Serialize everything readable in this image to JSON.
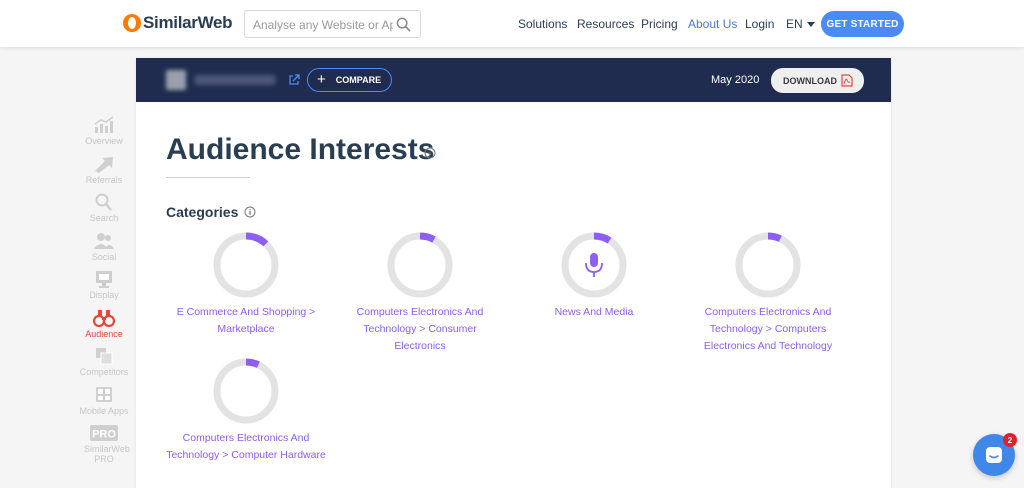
{
  "nav": {
    "logo_text": "SimilarWeb",
    "search_placeholder": "Analyse any Website or App",
    "links": [
      "Solutions",
      "Resources",
      "Pricing",
      "About Us",
      "Login"
    ],
    "active_link": "About Us",
    "language": "EN",
    "cta_label": "GET STARTED",
    "accent_color": "#4b8bf5"
  },
  "sidebar": {
    "items": [
      {
        "label": "Overview",
        "icon": "chart-icon"
      },
      {
        "label": "Referrals",
        "icon": "arrows-icon"
      },
      {
        "label": "Search",
        "icon": "search-icon"
      },
      {
        "label": "Social",
        "icon": "people-icon"
      },
      {
        "label": "Display",
        "icon": "display-icon"
      },
      {
        "label": "Audience",
        "icon": "binoculars-icon",
        "active": true
      },
      {
        "label": "Competitors",
        "icon": "competitors-icon"
      },
      {
        "label": "Mobile Apps",
        "icon": "mobile-icon"
      },
      {
        "label": "SimilarWeb PRO",
        "badge": "PRO",
        "icon": "pro-icon"
      }
    ],
    "active_color": "#e8463a"
  },
  "header": {
    "compare_label": "COMPARE",
    "date": "May 2020",
    "download_label": "DOWNLOAD"
  },
  "main": {
    "title": "Audience Interests",
    "section_title": "Categories",
    "category_color": "#8c5ef2",
    "categories": [
      {
        "label": "E Commerce And Shopping > Marketplace",
        "share": 0.12
      },
      {
        "label": "Computers Electronics And Technology > Consumer Electronics",
        "share": 0.08
      },
      {
        "label": "News And Media",
        "share": 0.09,
        "icon": "microphone-icon"
      },
      {
        "label": "Computers Electronics And Technology > Computers Electronics And Technology",
        "share": 0.07
      },
      {
        "label": "Computers Electronics And Technology > Computer Hardware",
        "share": 0.07
      }
    ]
  },
  "chat": {
    "badge_count": "2"
  }
}
